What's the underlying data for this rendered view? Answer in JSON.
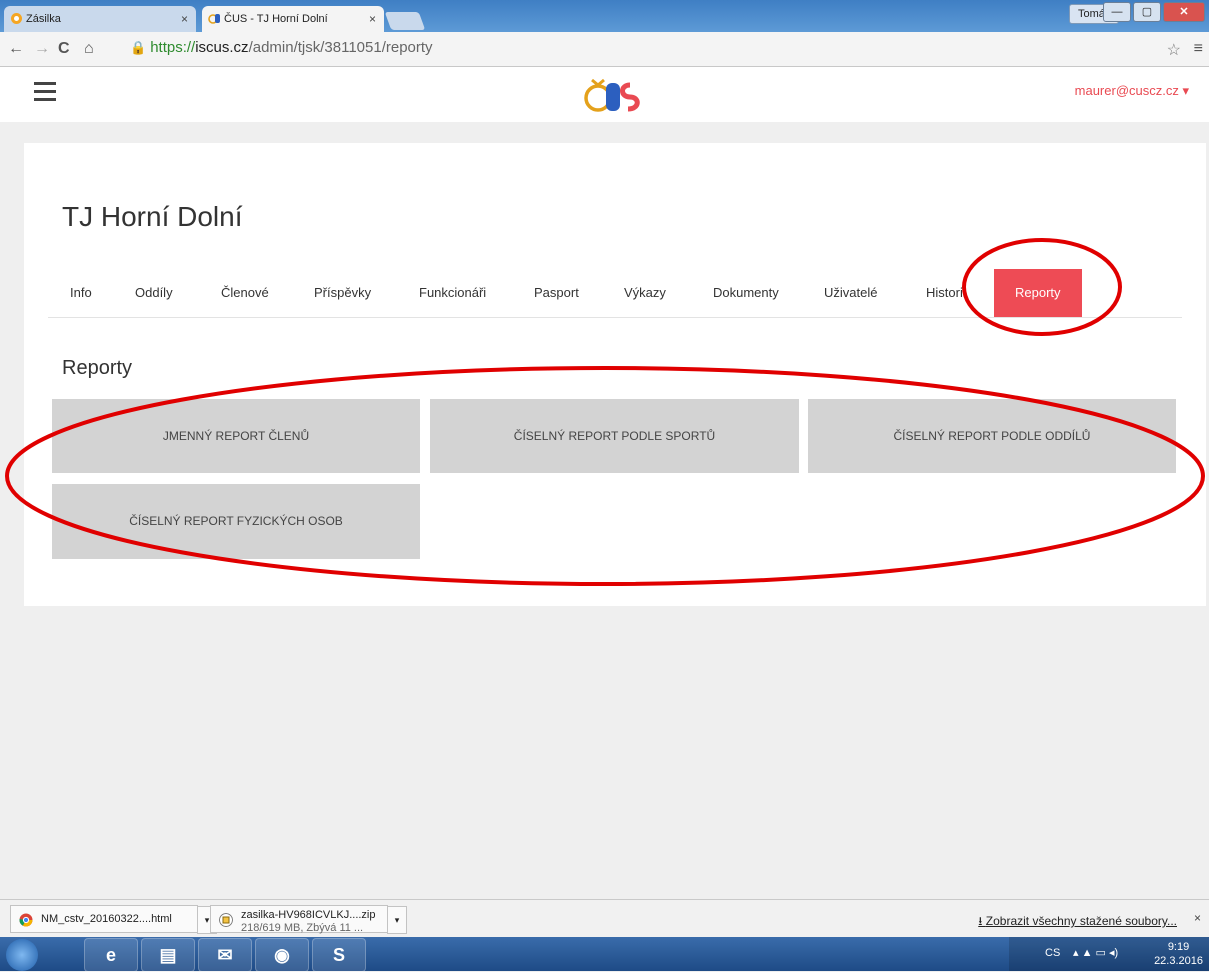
{
  "browser": {
    "tabs": [
      {
        "title": "Zásilka",
        "active": false
      },
      {
        "title": "ČUS - TJ Horní Dolní",
        "active": true
      }
    ],
    "close_glyph": "×",
    "user_badge": "Tomáš",
    "window_buttons": {
      "minimize": "—",
      "maximize": "▢",
      "close": "✕"
    },
    "nav": {
      "back": "←",
      "forward": "→",
      "reload": "C",
      "home": "⌂"
    },
    "url": {
      "protocol": "https://",
      "host": "iscus.cz",
      "path": "/admin/tjsk/3811051/reporty"
    },
    "bookmark_glyph": "☆",
    "menu_glyph": "≡"
  },
  "site": {
    "user_email": "maurer@cuscz.cz ▾",
    "org_title": "TJ Horní Dolní",
    "tabs": [
      {
        "label": "Info"
      },
      {
        "label": "Oddíly"
      },
      {
        "label": "Členové"
      },
      {
        "label": "Příspěvky"
      },
      {
        "label": "Funkcionáři"
      },
      {
        "label": "Pasport"
      },
      {
        "label": "Výkazy"
      },
      {
        "label": "Dokumenty"
      },
      {
        "label": "Uživatelé"
      },
      {
        "label": "Histori"
      },
      {
        "label": "Reporty",
        "active": true
      }
    ],
    "section_title": "Reporty",
    "reports": [
      {
        "label": "JMENNÝ REPORT ČLENŮ"
      },
      {
        "label": "ČÍSELNÝ REPORT PODLE SPORTŮ"
      },
      {
        "label": "ČÍSELNÝ REPORT PODLE ODDÍLŮ"
      },
      {
        "label": "ČÍSELNÝ REPORT FYZICKÝCH OSOB"
      }
    ],
    "accent_color": "#ee4b55",
    "annotation_color": "#e00000"
  },
  "downloads": {
    "items": [
      {
        "name": "NM_cstv_20160322....html",
        "icon": "chrome-icon"
      },
      {
        "name": "zasilka-HV968ICVLKJ....zip",
        "status": "218/619 MB, Zbývá 11 ...",
        "icon": "zip-icon"
      }
    ],
    "dropdown_glyph": "▾",
    "show_all": "Zobrazit všechny stažené soubory...",
    "close_glyph": "×"
  },
  "taskbar": {
    "apps": [
      {
        "name": "internet-explorer",
        "glyph": "e"
      },
      {
        "name": "file-explorer",
        "glyph": "▤"
      },
      {
        "name": "mail",
        "glyph": "✉"
      },
      {
        "name": "chrome",
        "glyph": "◉"
      },
      {
        "name": "skype",
        "glyph": "S"
      }
    ],
    "lang": "CS",
    "tray_icons": "▴ ▲ ▭ ◂)",
    "time": "9:19",
    "date": "22.3.2016"
  }
}
